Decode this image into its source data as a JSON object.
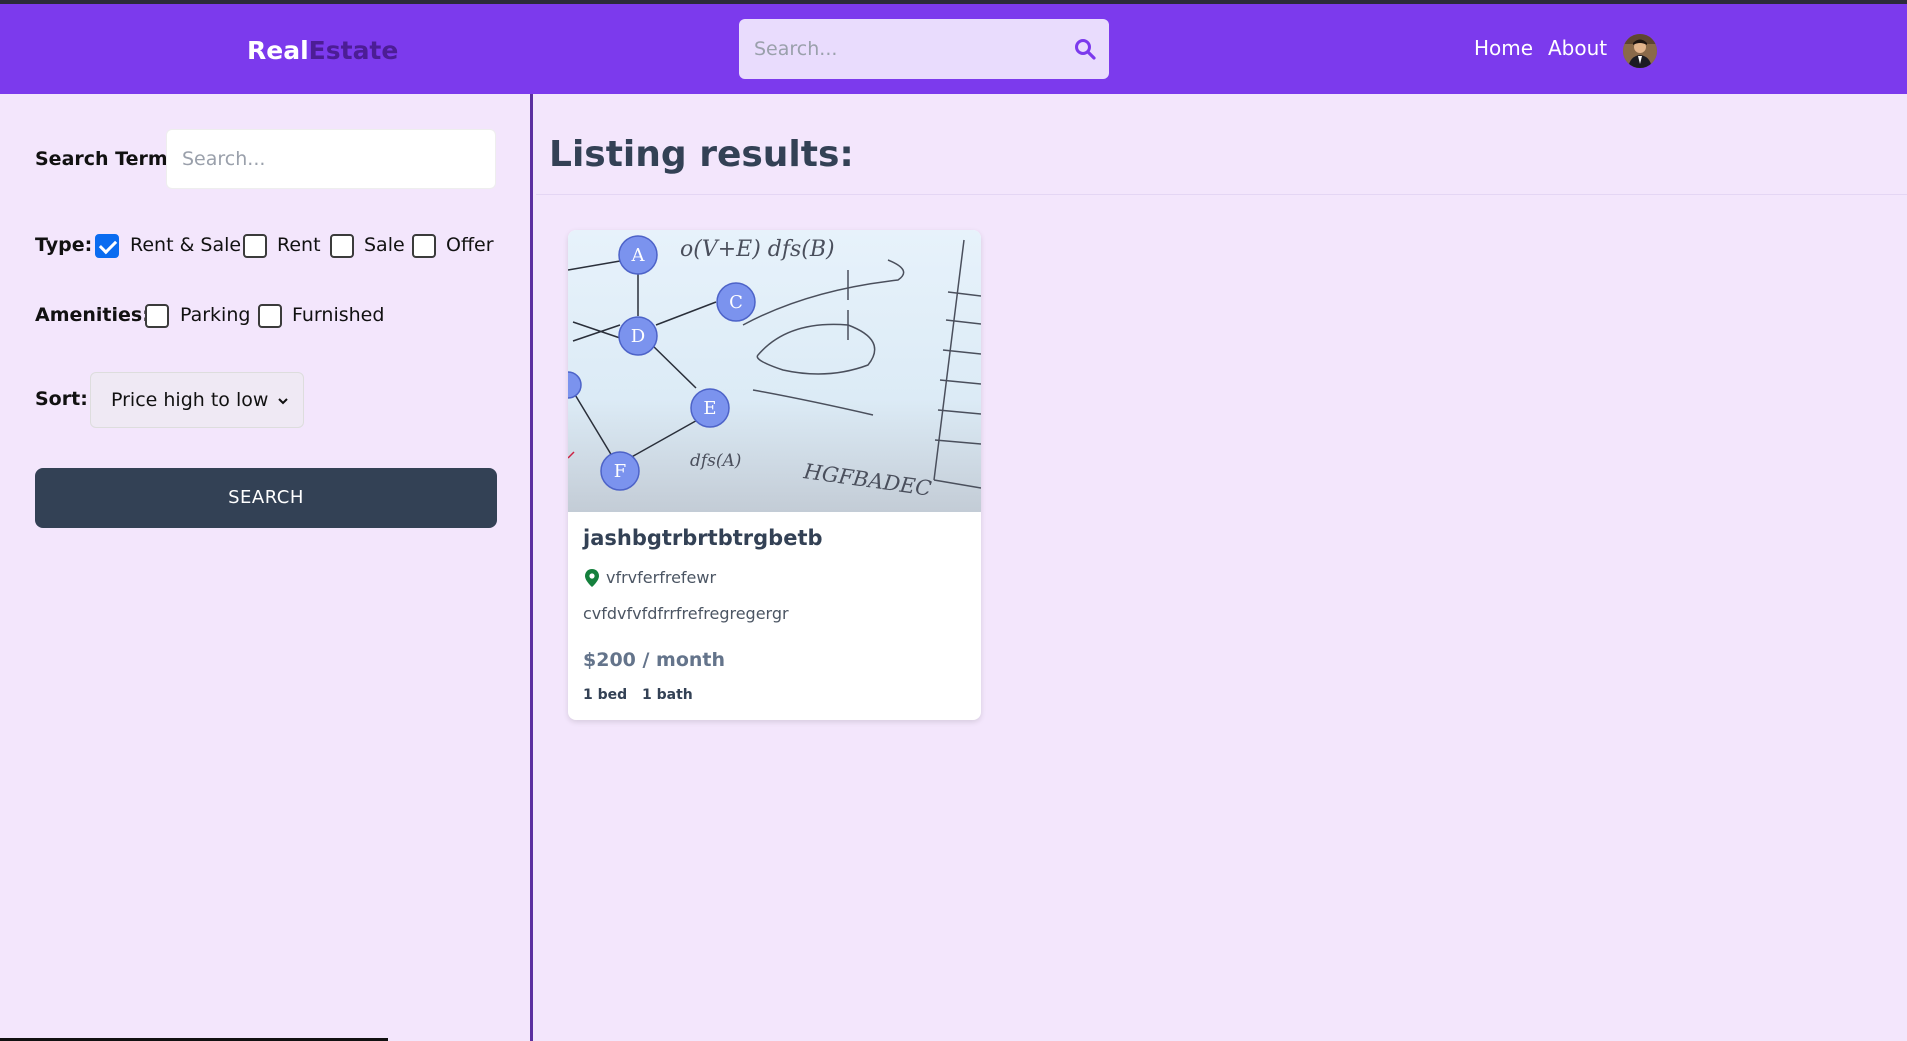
{
  "header": {
    "logo_part1": "Real",
    "logo_part2": "Estate",
    "search_placeholder": "Search...",
    "nav": [
      "Home",
      "About"
    ],
    "bg_color": "#7c3aed"
  },
  "sidebar": {
    "search_term_label": "Search Term:",
    "search_term_placeholder": "Search...",
    "type_label": "Type:",
    "type_options": [
      {
        "label": "Rent & Sale",
        "checked": true
      },
      {
        "label": "Rent",
        "checked": false
      },
      {
        "label": "Sale",
        "checked": false
      },
      {
        "label": "Offer",
        "checked": false
      }
    ],
    "amenities_label": "Amenities:",
    "amenity_options": [
      {
        "label": "Parking",
        "checked": false
      },
      {
        "label": "Furnished",
        "checked": false
      }
    ],
    "sort_label": "Sort:",
    "sort_value": "Price high to low",
    "search_button": "SEARCH"
  },
  "main": {
    "title": "Listing results:",
    "listings": [
      {
        "name": "jashbgtrbrtbtrgbetb",
        "address": "vfrvferfrefewr",
        "description": "cvfdvfvfdfrrfrefregregergr",
        "price": "$200 / month",
        "beds": "1 bed",
        "baths": "1 bath",
        "image_graph_nodes": [
          "A",
          "C",
          "D",
          "E",
          "F"
        ],
        "image_writing": [
          "o(V+E) dfs(B)",
          "dfs(A)",
          "HGFBADEC"
        ]
      }
    ]
  }
}
